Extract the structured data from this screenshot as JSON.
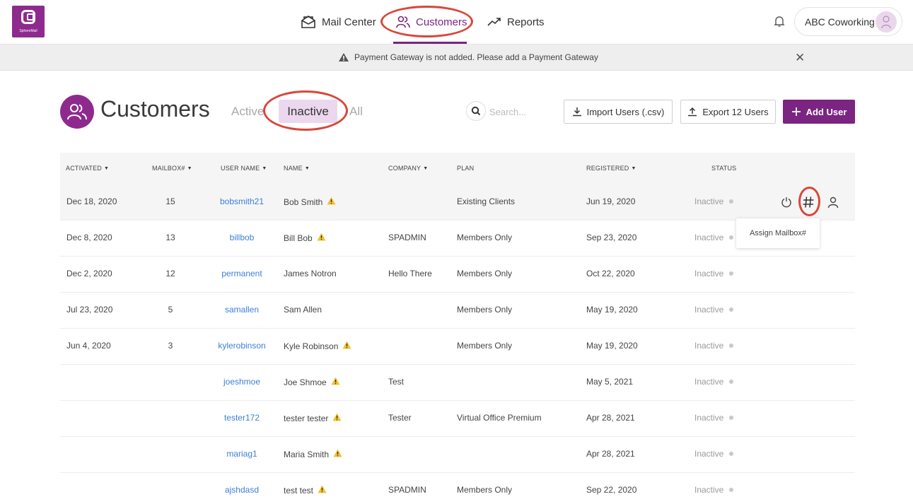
{
  "brand": {
    "logo_text": "SphereMail",
    "accent": "#7b2481"
  },
  "nav": {
    "items": [
      {
        "label": "Mail Center",
        "icon": "mail-icon"
      },
      {
        "label": "Customers",
        "icon": "users-icon"
      },
      {
        "label": "Reports",
        "icon": "trend-line-icon"
      }
    ],
    "active": "Customers"
  },
  "account": {
    "name": "ABC Coworking"
  },
  "banner": {
    "message": "Payment Gateway is not added. Please add a  Payment Gateway"
  },
  "page": {
    "title": "Customers",
    "tabs": [
      "Active",
      "Inactive",
      "All"
    ],
    "selected_tab": "Inactive",
    "search_placeholder": "Search...",
    "buttons": {
      "import": "Import Users (.csv)",
      "export": "Export 12 Users",
      "add": "Add User"
    }
  },
  "table": {
    "columns": [
      "ACTIVATED",
      "MAILBOX#",
      "USER NAME",
      "NAME",
      "COMPANY",
      "PLAN",
      "REGISTERED",
      "STATUS"
    ],
    "rows": [
      {
        "activated": "Dec 18, 2020",
        "mailbox": "15",
        "username": "bobsmith21",
        "name": "Bob Smith",
        "warn": true,
        "company": "",
        "plan": "Existing Clients",
        "registered": "Jun 19, 2020",
        "status": "Inactive"
      },
      {
        "activated": "Dec 8, 2020",
        "mailbox": "13",
        "username": "billbob",
        "name": "Bill Bob",
        "warn": true,
        "company": "SPADMIN",
        "plan": "Members Only",
        "registered": "Sep 23, 2020",
        "status": "Inactive"
      },
      {
        "activated": "Dec 2, 2020",
        "mailbox": "12",
        "username": "permanent",
        "name": "James Notron",
        "warn": false,
        "company": "Hello There",
        "plan": "Members Only",
        "registered": "Oct 22, 2020",
        "status": "Inactive"
      },
      {
        "activated": "Jul 23, 2020",
        "mailbox": "5",
        "username": "samallen",
        "name": "Sam Allen",
        "warn": false,
        "company": "",
        "plan": "Members Only",
        "registered": "May 19, 2020",
        "status": "Inactive"
      },
      {
        "activated": "Jun 4, 2020",
        "mailbox": "3",
        "username": "kylerobinson",
        "name": "Kyle Robinson",
        "warn": true,
        "company": "",
        "plan": "Members Only",
        "registered": "May 19, 2020",
        "status": "Inactive"
      },
      {
        "activated": "",
        "mailbox": "",
        "username": "joeshmoe",
        "name": "Joe Shmoe",
        "warn": true,
        "company": "Test",
        "plan": "",
        "registered": "May 5, 2021",
        "status": "Inactive"
      },
      {
        "activated": "",
        "mailbox": "",
        "username": "tester172",
        "name": "tester tester",
        "warn": true,
        "company": "Tester",
        "plan": "Virtual Office Premium",
        "registered": "Apr 28, 2021",
        "status": "Inactive"
      },
      {
        "activated": "",
        "mailbox": "",
        "username": "mariag1",
        "name": "Maria Smith",
        "warn": true,
        "company": "",
        "plan": "",
        "registered": "Apr 28, 2021",
        "status": "Inactive"
      },
      {
        "activated": "",
        "mailbox": "",
        "username": "ajshdasd",
        "name": "test test",
        "warn": true,
        "company": "SPADMIN",
        "plan": "Members Only",
        "registered": "Sep 22, 2020",
        "status": "Inactive"
      }
    ],
    "row_actions": [
      "power-icon",
      "hash-icon",
      "user-icon"
    ],
    "tooltip": "Assign Mailbox#"
  }
}
